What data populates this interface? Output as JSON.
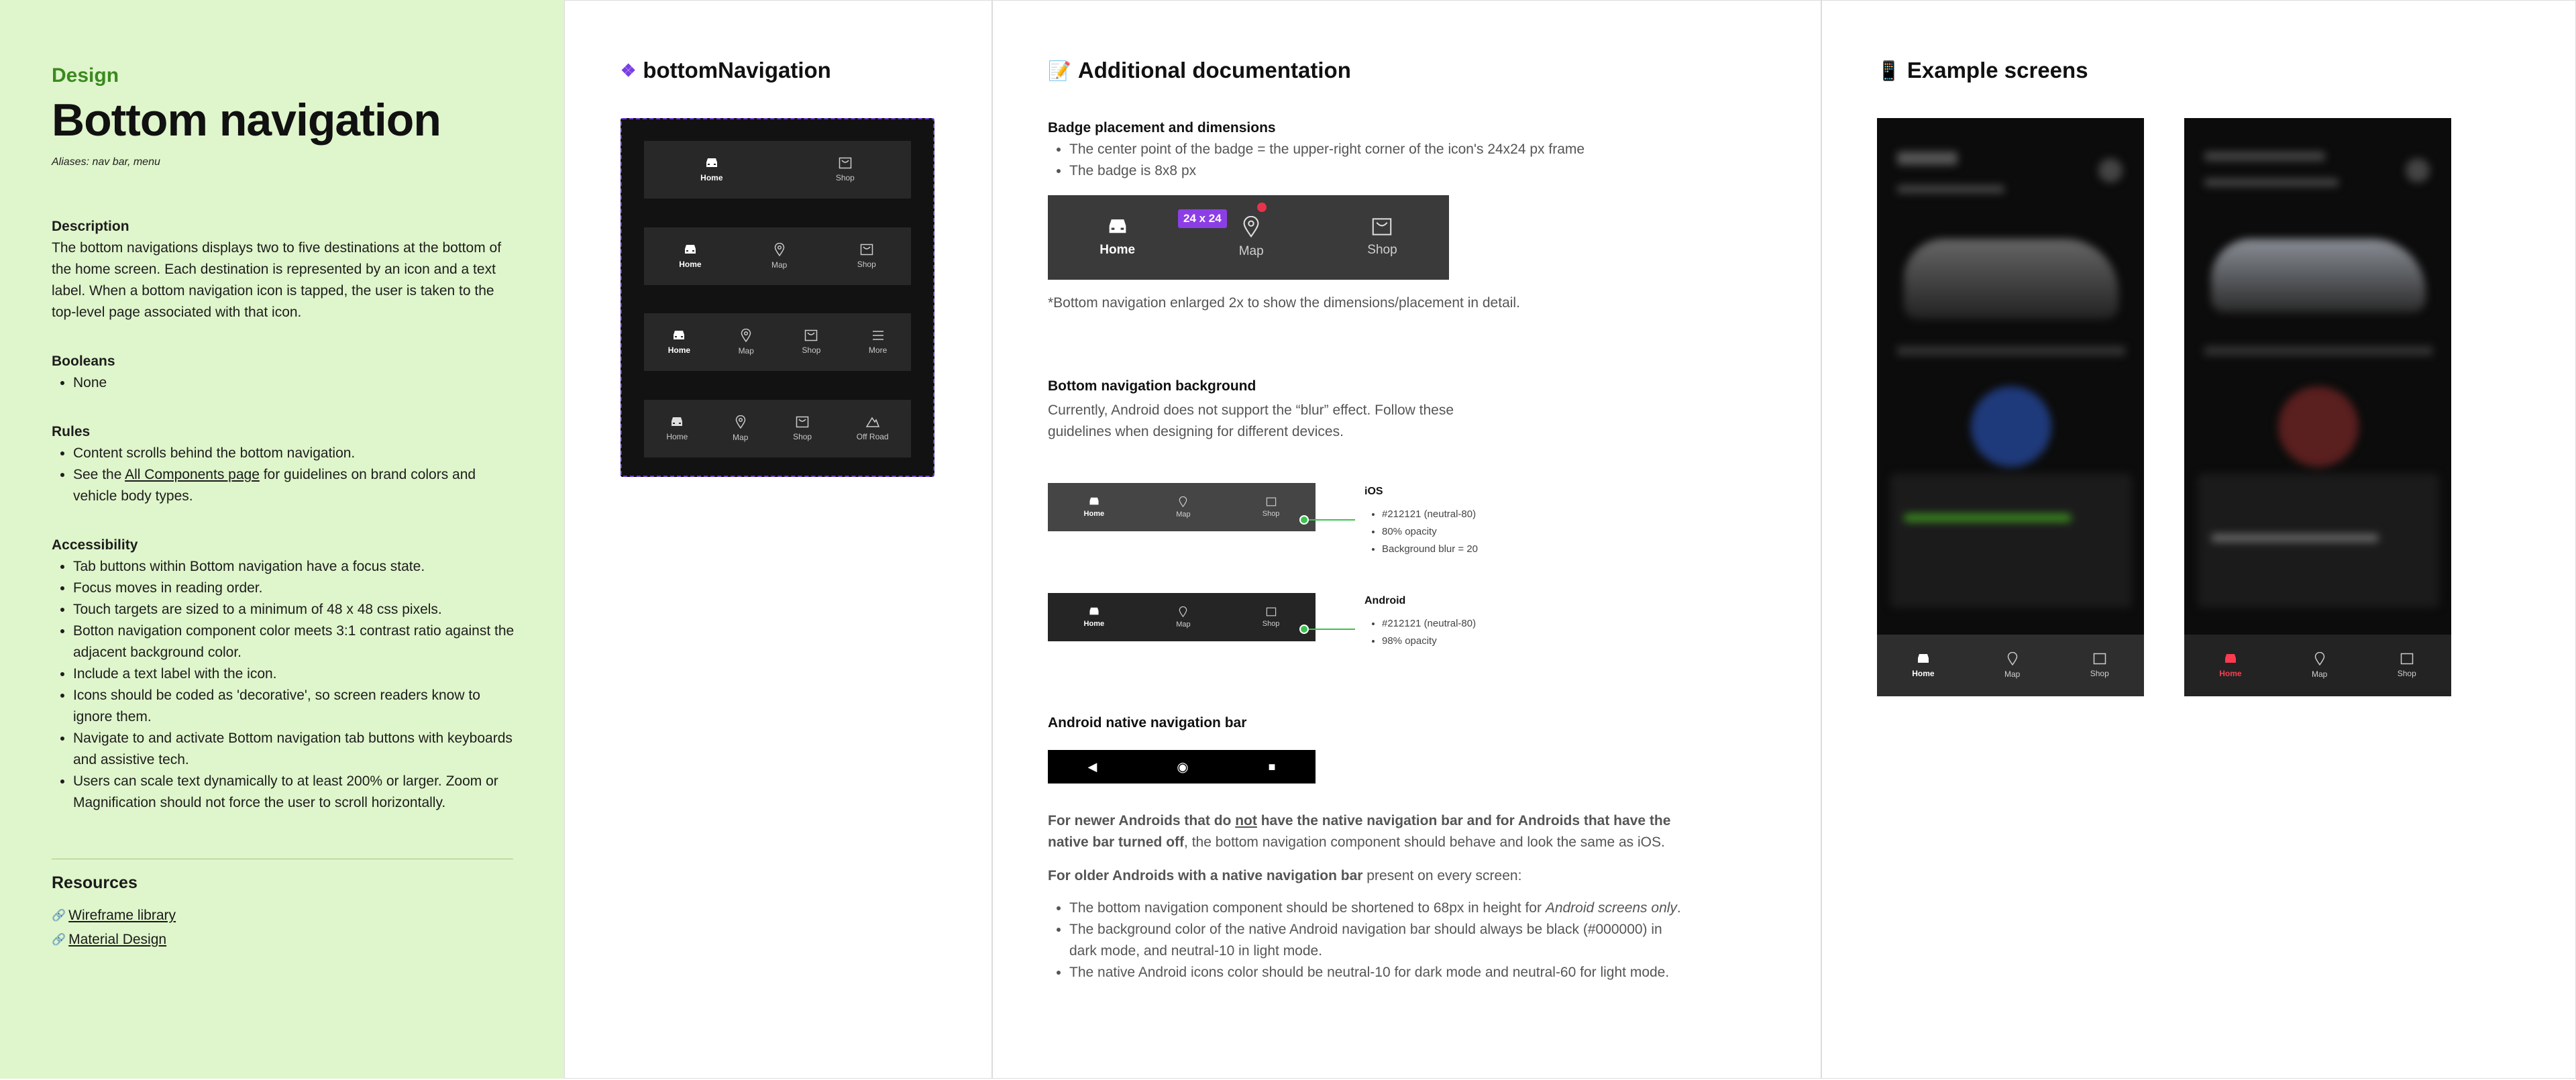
{
  "design": {
    "eyebrow": "Design",
    "title": "Bottom navigation",
    "aliases": "Aliases: nav bar, menu",
    "description_heading": "Description",
    "description": "The bottom navigations displays two to five destinations at the bottom of the home screen. Each destination is represented by an icon and a text label. When a bottom navigation icon is tapped, the user is taken to the top-level page associated with that icon.",
    "booleans_heading": "Booleans",
    "booleans": [
      "None"
    ],
    "rules_heading": "Rules",
    "rule_1": "Content scrolls behind the bottom navigation.",
    "rule_2_prefix": "See the ",
    "rule_2_link": "All Components page",
    "rule_2_suffix": " for guidelines on brand colors and vehicle body types.",
    "accessibility_heading": "Accessibility",
    "accessibility": [
      "Tab buttons within Bottom navigation have a focus state.",
      "Focus moves in reading order.",
      "Touch targets are sized to a minimum of 48 x 48 css pixels.",
      "Botton navigation component color meets 3:1 contrast ratio against the adjacent background color.",
      "Include a text label with the icon.",
      "Icons should be coded as 'decorative', so screen readers know to ignore them.",
      "Navigate to and activate Bottom navigation tab buttons with keyboards and assistive tech.",
      "Users can scale text dynamically to at least 200% or larger. Zoom or Magnification  should not force the user to scroll horizontally."
    ],
    "resources_heading": "Resources",
    "resources": [
      "Wireframe library",
      "Material Design"
    ]
  },
  "component": {
    "heading": "bottomNavigation",
    "variants": [
      [
        "Home",
        "Shop"
      ],
      [
        "Home",
        "Map",
        "Shop"
      ],
      [
        "Home",
        "Map",
        "Shop",
        "More"
      ],
      [
        "Home",
        "Map",
        "Shop",
        "Off Road"
      ]
    ]
  },
  "docs": {
    "heading": "Additional documentation",
    "badge_heading": "Badge placement and dimensions",
    "badge_bullets": [
      "The center point of the badge = the upper-right corner of the icon's 24x24 px frame",
      "The badge is 8x8 px"
    ],
    "badge_size_label": "24 x 24",
    "enlarged_tabs": [
      "Home",
      "Map",
      "Shop"
    ],
    "enlarged_note": "*Bottom navigation enlarged 2x to show the dimensions/placement in detail.",
    "bg_heading": "Bottom navigation background",
    "bg_text": "Currently, Android does not support the “blur” effect. Follow these guidelines when designing for different devices.",
    "ios_label": "iOS",
    "ios_notes": [
      "#212121 (neutral-80)",
      "80% opacity",
      "Background blur = 20"
    ],
    "android_label": "Android",
    "android_notes": [
      "#212121 (neutral-80)",
      "98% opacity"
    ],
    "small_tabs": [
      "Home",
      "Map",
      "Shop"
    ],
    "native_heading": "Android native navigation bar",
    "para1_bold_a": "For newer Androids that do ",
    "para1_underline": "not",
    "para1_bold_b": " have the native navigation bar and for Androids that have the native bar turned off",
    "para1_rest": ", the bottom navigation component should behave and look the same as iOS.",
    "para2_bold": "For older Androids with a native navigation bar",
    "para2_rest": " present on every screen:",
    "older_bullet_1": "The bottom navigation component should be shortened to 68px in height for ",
    "older_bullet_1_em": "Android screens only",
    "older_bullet_1_end": ".",
    "older_bullet_2": "The background color of the native Android navigation bar should always be black (#000000) in dark mode, and neutral-10 in light mode.",
    "older_bullet_3": "The native Android icons color should be neutral-10 for dark mode and neutral-60 for light mode."
  },
  "examples": {
    "heading": "Example screens",
    "tabs": [
      "Home",
      "Map",
      "Shop"
    ]
  },
  "colors": {
    "panel_green": "#dff5cb",
    "eyebrow_green": "#3b8a20",
    "badge_purple": "#8c3ee6",
    "badge_red": "#e8334a",
    "connector_green": "#3cc44d"
  }
}
